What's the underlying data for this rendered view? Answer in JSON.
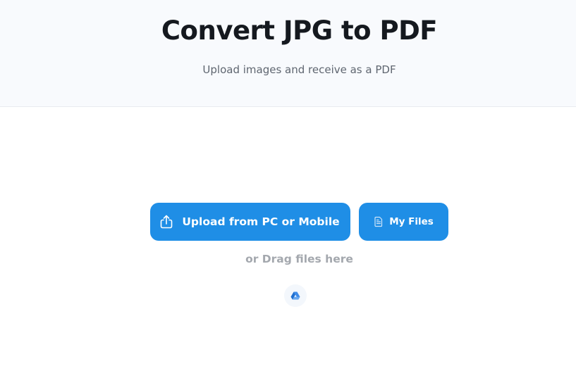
{
  "header": {
    "title": "Convert JPG to PDF",
    "subtitle": "Upload images and receive as a PDF"
  },
  "upload": {
    "upload_button_label": "Upload from PC or Mobile",
    "my_files_button_label": "My Files",
    "drag_text": "or Drag files here"
  },
  "icons": {
    "upload": "upload-share-icon",
    "my_files": "document-icon",
    "cloud_drive": "google-drive-icon"
  },
  "colors": {
    "accent": "#1f8ee6",
    "title": "#15191f",
    "muted": "#a4a8ae",
    "header_bg": "#f8fafd"
  }
}
